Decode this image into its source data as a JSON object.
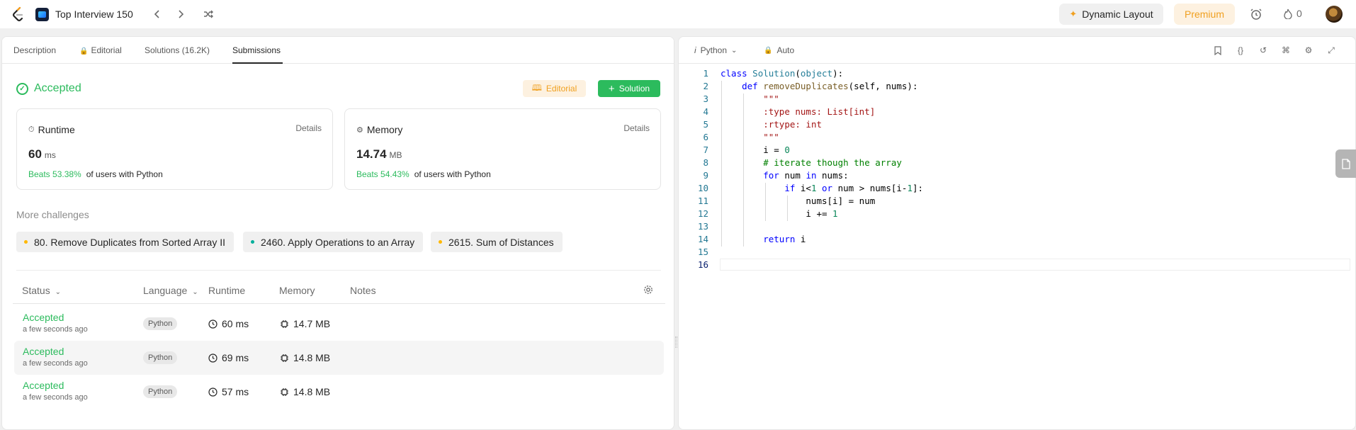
{
  "topnav": {
    "list_title": "Top Interview 150",
    "dynamic_layout": "Dynamic Layout",
    "premium": "Premium",
    "streak": "0"
  },
  "left_tabs": {
    "description": "Description",
    "editorial": "Editorial",
    "solutions": "Solutions (16.2K)",
    "submissions": "Submissions"
  },
  "result": {
    "status": "Accepted",
    "editorial_btn": "Editorial",
    "solution_btn": "Solution"
  },
  "runtime_card": {
    "title": "Runtime",
    "details": "Details",
    "value": "60",
    "unit": "ms",
    "beats": "Beats 53.38%",
    "suffix": "of users with Python"
  },
  "memory_card": {
    "title": "Memory",
    "details": "Details",
    "value": "14.74",
    "unit": "MB",
    "beats": "Beats 54.43%",
    "suffix": "of users with Python"
  },
  "more_challenges": {
    "title": "More challenges",
    "items": [
      {
        "label": "80. Remove Duplicates from Sorted Array II",
        "color": "#ffb800"
      },
      {
        "label": "2460. Apply Operations to an Array",
        "color": "#00af9b"
      },
      {
        "label": "2615. Sum of Distances",
        "color": "#ffb800"
      }
    ]
  },
  "table": {
    "headers": {
      "status": "Status",
      "language": "Language",
      "runtime": "Runtime",
      "memory": "Memory",
      "notes": "Notes"
    },
    "rows": [
      {
        "status": "Accepted",
        "time": "a few seconds ago",
        "language": "Python",
        "runtime": "60 ms",
        "memory": "14.7 MB"
      },
      {
        "status": "Accepted",
        "time": "a few seconds ago",
        "language": "Python",
        "runtime": "69 ms",
        "memory": "14.8 MB"
      },
      {
        "status": "Accepted",
        "time": "a few seconds ago",
        "language": "Python",
        "runtime": "57 ms",
        "memory": "14.8 MB"
      }
    ]
  },
  "editor": {
    "language": "Python",
    "mode": "Auto",
    "line_numbers": [
      "1",
      "2",
      "3",
      "4",
      "5",
      "6",
      "7",
      "8",
      "9",
      "10",
      "11",
      "12",
      "13",
      "14",
      "15",
      "16"
    ]
  },
  "colors": {
    "accent_green": "#2cbb5d",
    "accent_orange": "#f0a020"
  }
}
